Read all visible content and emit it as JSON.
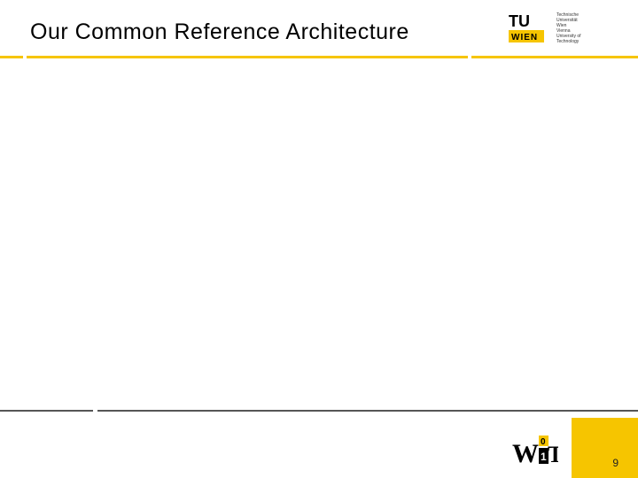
{
  "title": "Our Common Reference Architecture",
  "tu_logo": {
    "tu": "TU",
    "wien": "WIEN",
    "line1": "Technische",
    "line2": "Universität",
    "line3": "Wien",
    "line4": "Vienna",
    "line5": "University of",
    "line6": "Technology"
  },
  "wit_logo": {
    "w": "W",
    "t": "T",
    "i_top": "0",
    "i_bot": "1"
  },
  "page_number": "9",
  "colors": {
    "accent": "#f6c500",
    "rule": "#555555"
  }
}
